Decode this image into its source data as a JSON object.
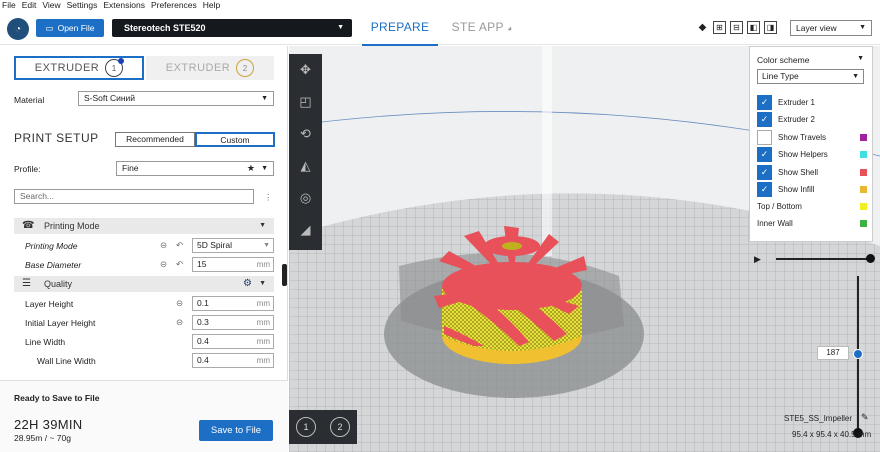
{
  "menu": [
    "File",
    "Edit",
    "View",
    "Settings",
    "Extensions",
    "Preferences",
    "Help"
  ],
  "header": {
    "open_file": "Open File",
    "printer": "Stereotech STE520",
    "stage_prepare": "PREPARE",
    "stage_steapp": "STE APP",
    "view_mode": "Layer view"
  },
  "extruders": [
    {
      "label": "EXTRUDER",
      "num": "1"
    },
    {
      "label": "EXTRUDER",
      "num": "2"
    }
  ],
  "material": {
    "label": "Material",
    "value": "S-Soft Синий"
  },
  "print_setup": {
    "title": "PRINT SETUP",
    "recommended": "Recommended",
    "custom": "Custom",
    "profile_label": "Profile:",
    "profile_value": "Fine",
    "search_placeholder": "Search..."
  },
  "sections": {
    "printing_mode": "Printing Mode",
    "quality": "Quality"
  },
  "settings": [
    {
      "name": "Printing Mode",
      "value": "5D Spiral",
      "unit": ""
    },
    {
      "name": "Base Diameter",
      "value": "15",
      "unit": "mm"
    },
    {
      "name": "Layer Height",
      "value": "0.1",
      "unit": "mm"
    },
    {
      "name": "Initial Layer Height",
      "value": "0.3",
      "unit": "mm"
    },
    {
      "name": "Line Width",
      "value": "0.4",
      "unit": "mm"
    },
    {
      "name": "Wall Line Width",
      "value": "0.4",
      "unit": "mm"
    }
  ],
  "output": {
    "ready": "Ready to Save to File",
    "time": "22H 39MIN",
    "material": "28.95m / ~ 70g",
    "save": "Save to File"
  },
  "color_scheme": {
    "title": "Color scheme",
    "value": "Line Type",
    "items": [
      {
        "label": "Extruder 1",
        "checked": true,
        "color": ""
      },
      {
        "label": "Extruder 2",
        "checked": true,
        "color": ""
      },
      {
        "label": "Show Travels",
        "checked": false,
        "color": "#a020a0"
      },
      {
        "label": "Show Helpers",
        "checked": true,
        "color": "#40e0e0"
      },
      {
        "label": "Show Shell",
        "checked": true,
        "color": "#e8505a"
      },
      {
        "label": "Show Infill",
        "checked": true,
        "color": "#e8b830"
      },
      {
        "label": "Top / Bottom",
        "checked": null,
        "color": "#f0f020"
      },
      {
        "label": "Inner Wall",
        "checked": null,
        "color": "#40b040"
      }
    ]
  },
  "layer": {
    "current": "187"
  },
  "object": {
    "name": "STE5_SS_Impeller",
    "dims": "95.4 x 95.4 x 40.5 mm"
  },
  "extruder_buttons": [
    "1",
    "2"
  ],
  "colors": {
    "accent": "#1c6fc5",
    "model_red": "#e8505a",
    "model_yellow": "#e6e13a"
  }
}
